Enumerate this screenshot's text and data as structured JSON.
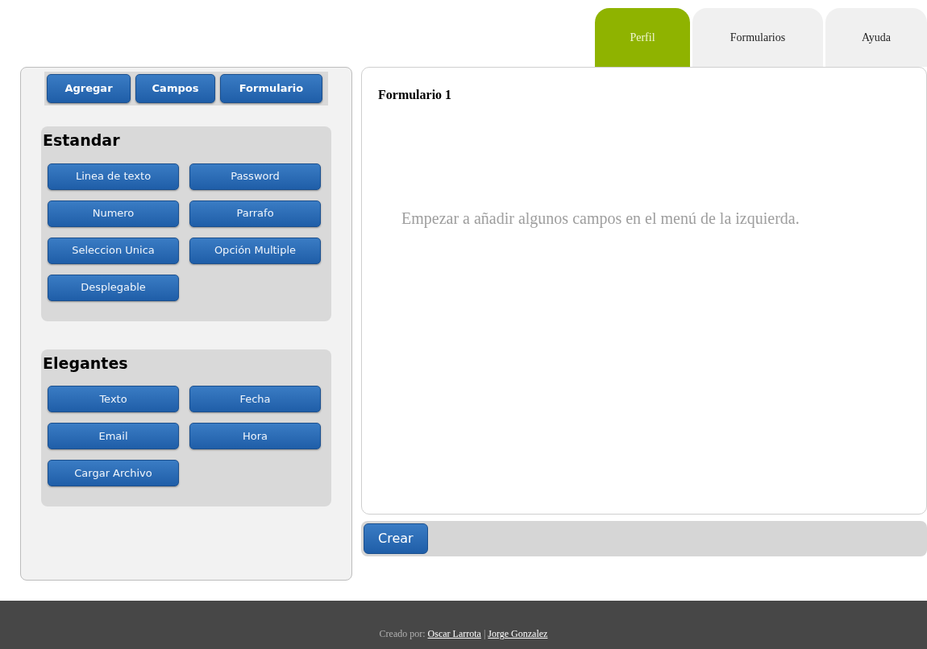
{
  "tabs": [
    {
      "label": "Perfil",
      "selected": true
    },
    {
      "label": "Formularios",
      "selected": false
    },
    {
      "label": "Ayuda",
      "selected": false
    }
  ],
  "sidebar": {
    "toolbar": [
      "Agregar",
      "Campos",
      "Formulario"
    ],
    "sections": [
      {
        "title": "Estandar",
        "items": [
          "Linea de texto",
          "Password",
          "Numero",
          "Parrafo",
          "Seleccion Unica",
          "Opción Multiple",
          "Desplegable"
        ]
      },
      {
        "title": "Elegantes",
        "items": [
          "Texto",
          "Fecha",
          "Email",
          "Hora",
          "Cargar Archivo"
        ]
      }
    ]
  },
  "form": {
    "title": "Formulario 1",
    "hint": "Empezar a añadir algunos campos en el menú de la izquierda."
  },
  "action_button": "Crear",
  "footer": {
    "label": "Creado por:",
    "links": [
      "Oscar Larrota",
      "Jorge Gonzalez"
    ],
    "separator": "|"
  }
}
